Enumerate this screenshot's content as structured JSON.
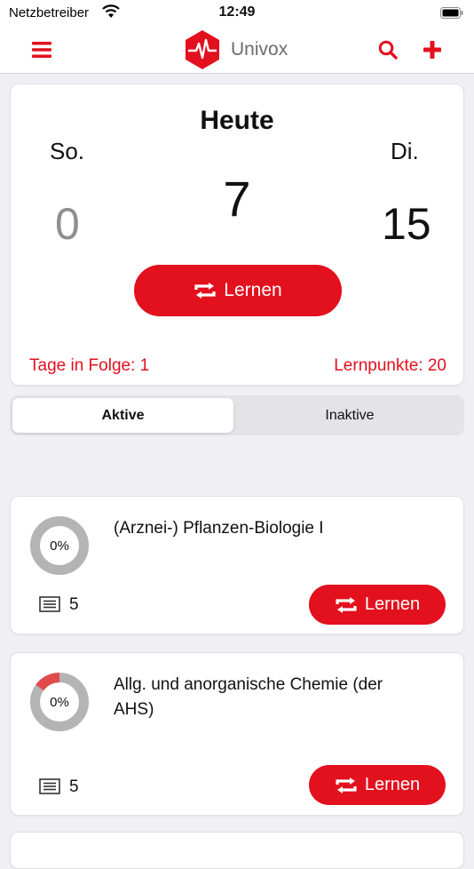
{
  "statusbar": {
    "carrier": "Netzbetreiber",
    "time": "12:49"
  },
  "app": {
    "name": "Univox",
    "accent": "#e3101e"
  },
  "icons": {
    "menu": "hamburger-menu-icon",
    "search": "search-icon",
    "add": "plus-icon",
    "repeat": "repeat-icon",
    "cards": "card-stack-icon"
  },
  "today": {
    "title": "Heute",
    "prev_day": "So.",
    "next_day": "Di.",
    "prev_count": "0",
    "today_count": "7",
    "next_count": "15",
    "learn_label": "Lernen",
    "streak": "Tage in Folge: 1",
    "points": "Lernpunkte: 20"
  },
  "segments": {
    "active": "Aktive",
    "inactive": "Inaktive",
    "selected": "Aktive"
  },
  "decks": [
    {
      "title": "(Arznei-) Pflanzen-Biologie I",
      "progress_label": "0%",
      "progress_fraction": 0,
      "card_count": "5",
      "learn_label": "Lernen"
    },
    {
      "title": "Allg. und anorganische Chemie (der AHS)",
      "progress_label": "0%",
      "progress_fraction": 0.1,
      "card_count": "5",
      "learn_label": "Lernen"
    }
  ]
}
